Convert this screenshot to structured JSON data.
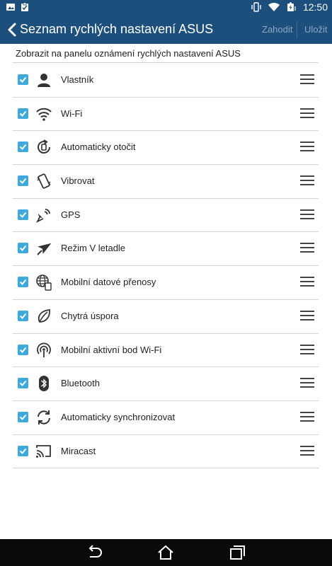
{
  "status_bar": {
    "time": "12:50",
    "icons": [
      "image-notification-icon",
      "clipboard-check-icon",
      "vibrate-icon",
      "wifi-icon",
      "battery-charging-icon"
    ]
  },
  "app_bar": {
    "title": "Seznam rychlých nastavení ASUS",
    "discard_label": "Zahodit",
    "save_label": "Uložit"
  },
  "subtitle": "Zobrazit na panelu oznámení rychlých nastavení ASUS",
  "items": [
    {
      "label": "Vlastník",
      "icon": "person-icon",
      "checked": true
    },
    {
      "label": "Wi-Fi",
      "icon": "wifi-icon",
      "checked": true
    },
    {
      "label": "Automaticky otočit",
      "icon": "auto-rotate-icon",
      "checked": true
    },
    {
      "label": "Vibrovat",
      "icon": "vibrate-icon",
      "checked": true
    },
    {
      "label": "GPS",
      "icon": "gps-satellite-icon",
      "checked": true
    },
    {
      "label": "Režim V letadle",
      "icon": "airplane-icon",
      "checked": true
    },
    {
      "label": "Mobilní datové přenosy",
      "icon": "mobile-data-globe-icon",
      "checked": true
    },
    {
      "label": "Chytrá úspora",
      "icon": "leaf-icon",
      "checked": true
    },
    {
      "label": "Mobilní aktivní bod Wi-Fi",
      "icon": "hotspot-icon",
      "checked": true
    },
    {
      "label": "Bluetooth",
      "icon": "bluetooth-icon",
      "checked": true
    },
    {
      "label": "Automaticky synchronizovat",
      "icon": "sync-icon",
      "checked": true
    },
    {
      "label": "Miracast",
      "icon": "cast-icon",
      "checked": true
    }
  ],
  "colors": {
    "app_bar": "#1d4f7d",
    "checkbox": "#3ea9dc",
    "action_disabled": "#8ea6bf"
  }
}
